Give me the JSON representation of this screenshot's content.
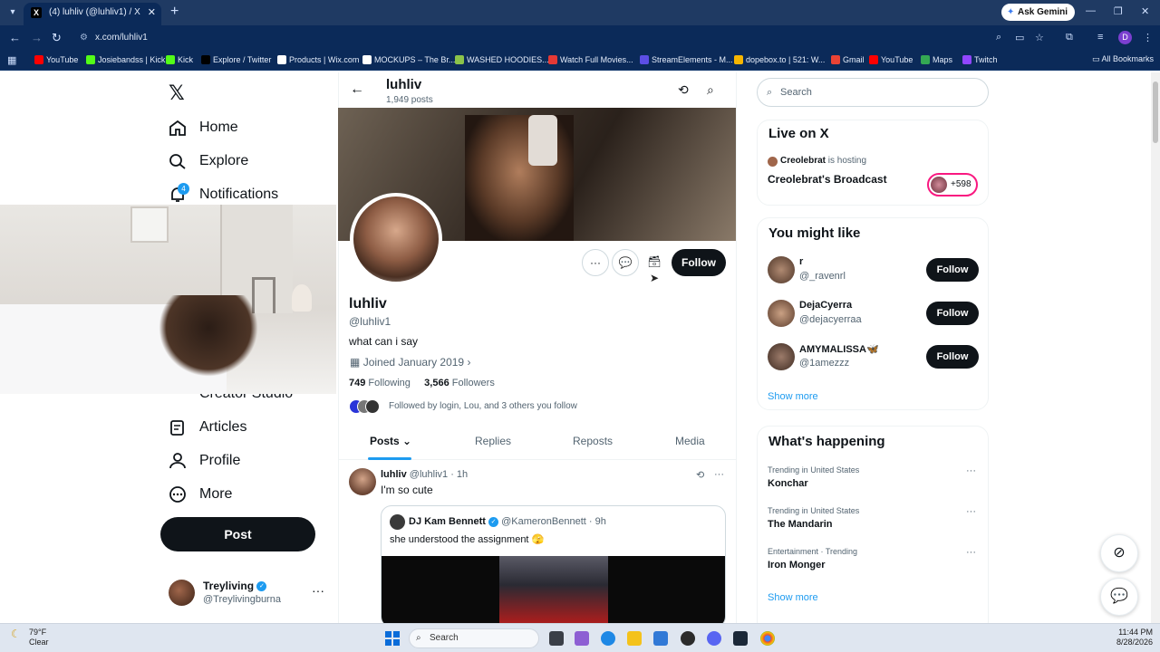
{
  "browser": {
    "tab_title": "(4) luhliv (@luhliv1) / X",
    "url": "x.com/luhliv1",
    "ask_gemini": "Ask Gemini",
    "profile_initial": "D",
    "bookmarks": [
      {
        "label": "YouTube",
        "color": "#ff0000"
      },
      {
        "label": "Josiebandss | Kick",
        "color": "#53fc18"
      },
      {
        "label": "Kick",
        "color": "#53fc18"
      },
      {
        "label": "Explore / Twitter",
        "color": "#000000"
      },
      {
        "label": "Products | Wix.com",
        "color": "#ffffff"
      },
      {
        "label": "MOCKUPS – The Br...",
        "color": "#ffffff"
      },
      {
        "label": "WASHED HOODIES...",
        "color": "#8bc34a"
      },
      {
        "label": "Watch Full Movies...",
        "color": "#e53935"
      },
      {
        "label": "StreamElements - M...",
        "color": "#5c4ee5"
      },
      {
        "label": "dopebox.to | 521: W...",
        "color": "#f6b500"
      },
      {
        "label": "Gmail",
        "color": "#ea4335"
      },
      {
        "label": "YouTube",
        "color": "#ff0000"
      },
      {
        "label": "Maps",
        "color": "#34a853"
      },
      {
        "label": "Twitch",
        "color": "#9146ff"
      }
    ],
    "all_bookmarks": "All Bookmarks"
  },
  "nav": {
    "home": "Home",
    "explore": "Explore",
    "notifications": "Notifications",
    "notif_count": "4",
    "creator_studio": "Creator Studio",
    "articles": "Articles",
    "profile": "Profile",
    "more": "More",
    "post": "Post",
    "account_name": "Treyliving",
    "account_handle": "@Treylivingburna"
  },
  "profile": {
    "header_name": "luhliv",
    "posts_count": "1,949 posts",
    "name": "luhliv",
    "handle": "@luhliv1",
    "bio": "what can i say",
    "joined": "Joined January 2019",
    "following_count": "749",
    "following_label": "Following",
    "followers_count": "3,566",
    "followers_label": "Followers",
    "followed_by": "Followed by login, Lou, and 3 others you follow",
    "follow_label": "Follow",
    "tabs": [
      "Posts",
      "Replies",
      "Reposts",
      "Media"
    ]
  },
  "tweet": {
    "name": "luhliv",
    "handle_time": "@luhliv1 · 1h",
    "text": "I'm so cute",
    "quote_name": "DJ Kam Bennett",
    "quote_handle_time": "@KameronBennett · 9h",
    "quote_text": "she understood the assignment 🫣"
  },
  "sidebar": {
    "search_placeholder": "Search",
    "live_title": "Live on X",
    "live_host": "Creolebrat",
    "live_hosting": "is hosting",
    "live_broadcast": "Creolebrat's Broadcast",
    "live_count": "+598",
    "you_might_like": "You might like",
    "suggestions": [
      {
        "name": "r",
        "handle": "@_ravenrl",
        "follow": "Follow"
      },
      {
        "name": "DejaCyerra",
        "handle": "@dejacyerraa",
        "follow": "Follow"
      },
      {
        "name": "AMYMALISSA🦋",
        "handle": "@1amezzz",
        "follow": "Follow"
      }
    ],
    "show_more": "Show more",
    "whats_happening": "What's happening",
    "trends": [
      {
        "context": "Trending in United States",
        "name": "Konchar"
      },
      {
        "context": "Trending in United States",
        "name": "The Mandarin"
      },
      {
        "context": "Entertainment · Trending",
        "name": "Iron Monger"
      }
    ],
    "show_more_2": "Show more"
  },
  "taskbar": {
    "temp": "79°F",
    "condition": "Clear",
    "search": "Search",
    "time": "11:44 PM",
    "date": "8/28/2026"
  }
}
